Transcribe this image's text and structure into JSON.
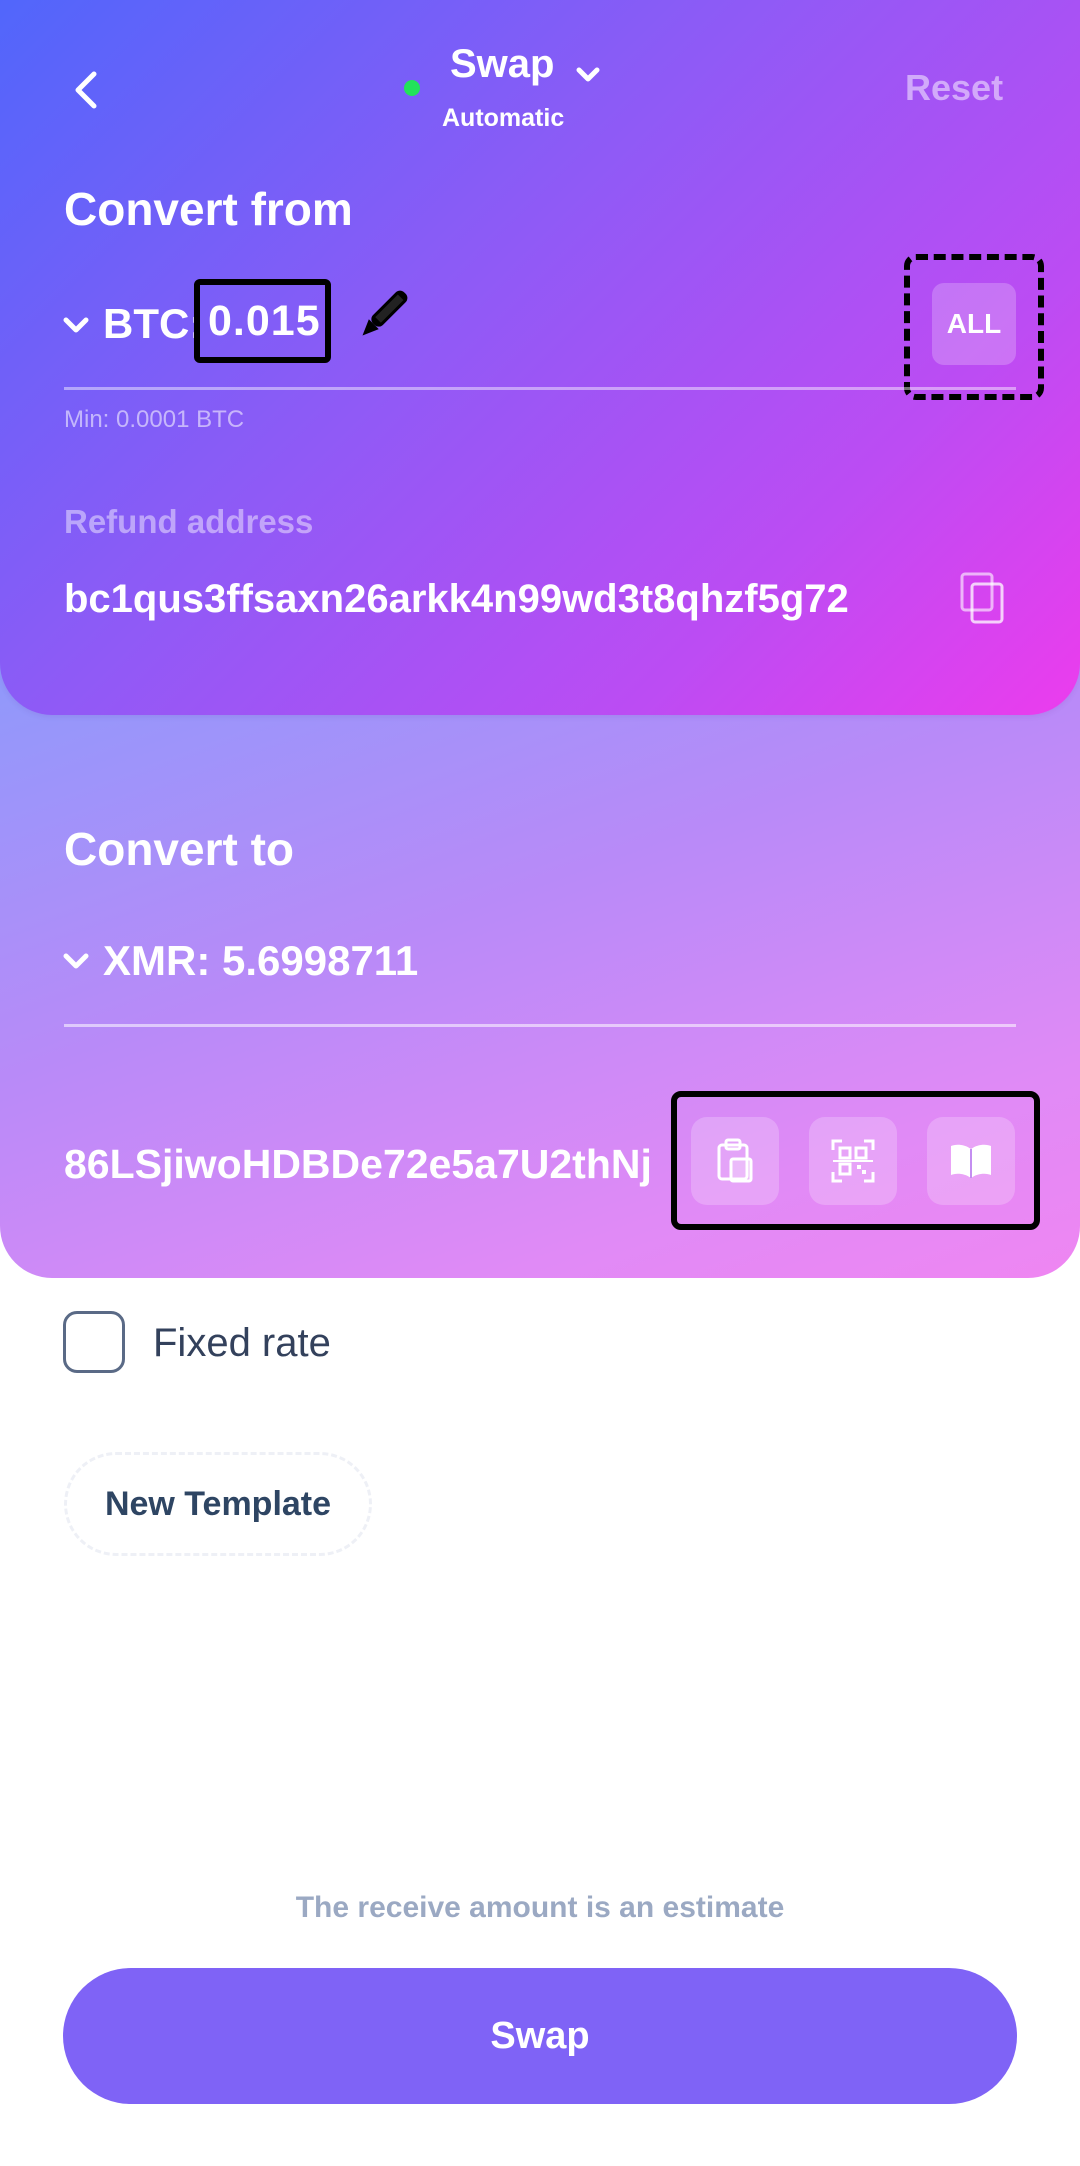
{
  "header": {
    "title": "Swap",
    "subtitle": "Automatic",
    "reset_label": "Reset",
    "status_color": "#22e35a"
  },
  "from": {
    "title": "Convert from",
    "currency": "BTC:",
    "amount": "0.015",
    "all_label": "ALL",
    "min_text": "Min: 0.0001 BTC",
    "refund_label": "Refund address",
    "refund_address": "bc1qus3ffsaxn26arkk4n99wd3t8qhzf5g72"
  },
  "to": {
    "title": "Convert to",
    "value": "XMR: 5.6998711",
    "address": "86LSjiwoHDBDe72e5a7U2thNj"
  },
  "options": {
    "fixed_rate_label": "Fixed rate",
    "fixed_rate_checked": false,
    "new_template_label": "New Template"
  },
  "footer": {
    "estimate_text": "The receive amount is an estimate",
    "swap_label": "Swap",
    "swap_color": "#7f63f6"
  },
  "icons": {
    "back": "chevron-left-icon",
    "title_dropdown": "chevron-down-icon",
    "edit": "pencil-icon",
    "copy": "copy-icon",
    "paste": "clipboard-icon",
    "scan": "qr-scan-icon",
    "address_book": "book-icon"
  }
}
